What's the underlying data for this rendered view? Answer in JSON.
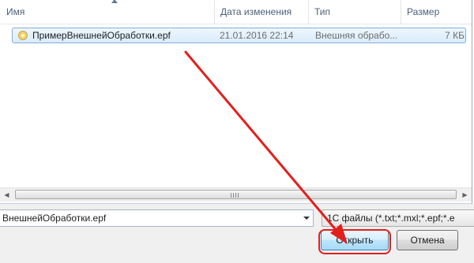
{
  "columns": {
    "name": "Имя",
    "date": "Дата изменения",
    "type": "Тип",
    "size": "Размер"
  },
  "files": [
    {
      "name": "ПримерВнешнейОбработки.epf",
      "date": "21.01.2016 22:14",
      "type": "Внешняя обрабо...",
      "size": "7 КБ"
    }
  ],
  "filename": "ВнешнейОбработки.epf",
  "filter": "1С файлы (*.txt;*.mxl;*.epf;*.e",
  "buttons": {
    "open": "Открыть",
    "cancel": "Отмена"
  },
  "colors": {
    "annotation": "#e0201e",
    "selection": "#d9ecfc"
  }
}
